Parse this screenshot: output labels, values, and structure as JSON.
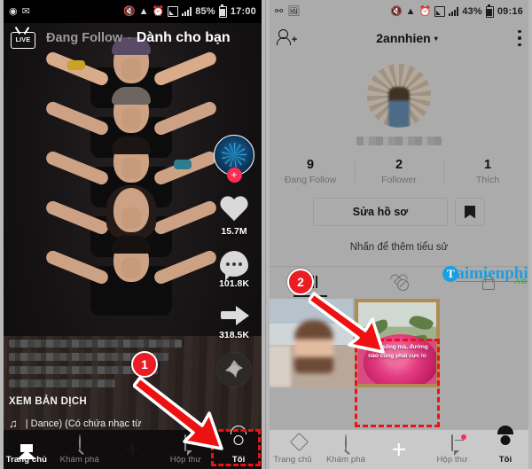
{
  "left_phone": {
    "status_bar": {
      "left_icons": [
        "messenger-icon",
        "email-icon"
      ],
      "mute_icon": "mute-icon",
      "wifi_icon": "wifi-icon",
      "alarm_icon": "alarm-icon",
      "signal_icon_1": "signal-icon",
      "signal_icon_2": "signal-icon",
      "battery_pct": "85%",
      "time": "17:00"
    },
    "header": {
      "live_label": "LIVE",
      "tab_following": "Đang Follow",
      "tab_separator": "·",
      "tab_foryou": "Dành cho bạn"
    },
    "action_rail": {
      "follow_plus": "+",
      "like_count": "15.7M",
      "comment_count": "101.8K",
      "share_count": "318.5K"
    },
    "caption": {
      "translate_label": "XEM BẢN DỊCH",
      "music_note": "♫",
      "music_text": "| Dance) (Có chứa nhạc từ"
    },
    "nav": {
      "home": "Trang chủ",
      "discover": "Khám phá",
      "create": "+",
      "inbox": "Hộp thư",
      "profile": "Tôi"
    }
  },
  "right_phone": {
    "status_bar": {
      "left_icons": [
        "contacts-icon",
        "gallery-icon"
      ],
      "mute_icon": "mute-icon",
      "wifi_icon": "wifi-icon",
      "alarm_icon": "alarm-icon",
      "signal_icon_1": "signal-icon",
      "signal_icon_2": "signal-icon",
      "battery_pct": "43%",
      "time": "09:16"
    },
    "header": {
      "add_friend_plus": "+",
      "username": "2annhien",
      "caret": "▾"
    },
    "stats": [
      {
        "num": "9",
        "label": "Đang Follow"
      },
      {
        "num": "2",
        "label": "Follower"
      },
      {
        "num": "1",
        "label": "Thích"
      }
    ],
    "actions": {
      "edit_profile": "Sửa hồ sơ",
      "bookmark_icon": "bookmark-icon"
    },
    "bio_placeholder": "Nhấn để thêm tiểu sử",
    "tabs": [
      {
        "icon": "grid-icon",
        "active": true
      },
      {
        "icon": "liked-hidden-icon",
        "active": false
      },
      {
        "icon": "lock-icon",
        "active": false
      }
    ],
    "thumbnails": [
      {
        "name": "video-thumbnail-person",
        "caption": ""
      },
      {
        "name": "video-thumbnail-rose",
        "caption": "Cuộc sống mà, đường nào cũng phải cực lo"
      }
    ],
    "nav": {
      "home": "Trang chủ",
      "discover": "Khám phá",
      "create": "+",
      "inbox": "Hộp thư",
      "profile": "Tôi"
    }
  },
  "annotations": {
    "step1": "1",
    "step2": "2"
  },
  "watermark": {
    "initial": "T",
    "name": "aimienphi",
    "tld": ".vn"
  },
  "colors": {
    "accent_red": "#fe2c55",
    "accent_cyan": "#23e5e7",
    "annotation_red": "#ee1111",
    "watermark_blue": "#1b9fe0",
    "watermark_green": "#3fae3f"
  }
}
